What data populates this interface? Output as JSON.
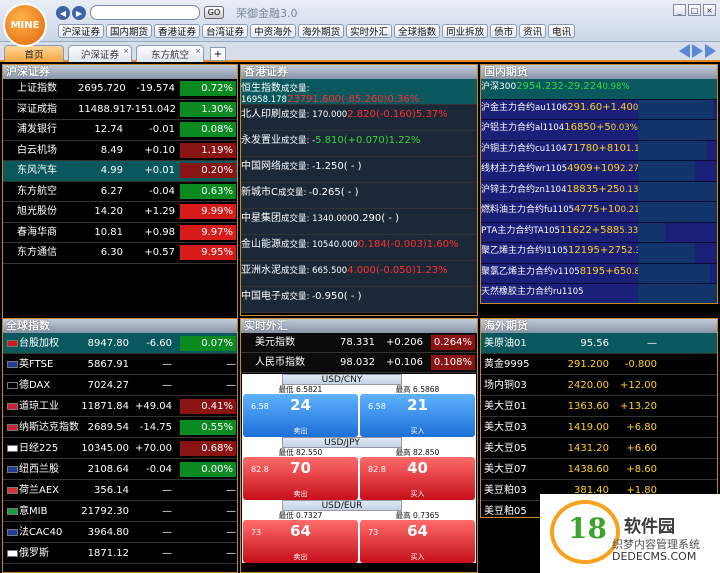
{
  "app": {
    "logo": "MINE",
    "title": "荣御金融3.0",
    "go": "GO",
    "search_value": ""
  },
  "categories": [
    "沪深证券",
    "国内期货",
    "香港证券",
    "台湾证券",
    "中资海外",
    "海外期货",
    "实时外汇",
    "全球指数",
    "同业拆放",
    "债市",
    "资讯",
    "电讯"
  ],
  "tabs": [
    "首页",
    "沪深证券",
    "东方航空"
  ],
  "panels": {
    "sh": {
      "title": "沪深证券",
      "rows": [
        {
          "name": "上证指数",
          "price": "2695.720",
          "chg": "-19.574",
          "pct": "0.72%",
          "c": "g"
        },
        {
          "name": "深证成指",
          "price": "11488.917",
          "chg": "-151.042",
          "pct": "1.30%",
          "c": "g"
        },
        {
          "name": "浦发银行",
          "price": "12.74",
          "chg": "-0.01",
          "pct": "0.08%",
          "c": "g"
        },
        {
          "name": "白云机场",
          "price": "8.49",
          "chg": "+0.10",
          "pct": "1.19%",
          "c": "r"
        },
        {
          "name": "东风汽车",
          "price": "4.99",
          "chg": "+0.01",
          "pct": "0.20%",
          "c": "r",
          "hl": true
        },
        {
          "name": "东方航空",
          "price": "6.27",
          "chg": "-0.04",
          "pct": "0.63%",
          "c": "g"
        },
        {
          "name": "旭光股份",
          "price": "14.20",
          "chg": "+1.29",
          "pct": "9.99%",
          "c": "R"
        },
        {
          "name": "春海华商",
          "price": "10.81",
          "chg": "+0.98",
          "pct": "9.97%",
          "c": "R"
        },
        {
          "name": "东方通信",
          "price": "6.30",
          "chg": "+0.57",
          "pct": "9.95%",
          "c": "R"
        }
      ]
    },
    "hk": {
      "title": "香港证券",
      "rows": [
        {
          "name": "恒生指数",
          "vol": "成交量: 16958.178",
          "price": "23791.600",
          "chg": "(-85.260)",
          "pct": "0.36%",
          "c": "r"
        },
        {
          "name": "北人印刷",
          "vol": "成交量: 170.000",
          "price": "2.820",
          "chg": "(-0.160)",
          "pct": "5.37%",
          "c": "r"
        },
        {
          "name": "永发置业",
          "vol": "成交量: -",
          "price": "5.810",
          "chg": "(+0.070)",
          "pct": "1.22%",
          "c": "g"
        },
        {
          "name": "中国网络",
          "vol": "成交量: -",
          "price": "1.250",
          "chg": "( - )",
          "pct": "",
          "c": "w"
        },
        {
          "name": "新城市C",
          "vol": "成交量: -",
          "price": "0.265",
          "chg": "( - )",
          "pct": "",
          "c": "w"
        },
        {
          "name": "中星集团",
          "vol": "成交量: 1340.000",
          "price": "0.290",
          "chg": "( - )",
          "pct": "",
          "c": "w"
        },
        {
          "name": "金山能源",
          "vol": "成交量: 10540.000",
          "price": "0.184",
          "chg": "(-0.003)",
          "pct": "1.60%",
          "c": "r"
        },
        {
          "name": "亚洲水泥",
          "vol": "成交量: 665.500",
          "price": "4.000",
          "chg": "(-0.050)",
          "pct": "1.23%",
          "c": "r"
        },
        {
          "name": "中国电子",
          "vol": "成交量: -",
          "price": "0.950",
          "chg": "( - )",
          "pct": "",
          "c": "w"
        }
      ]
    },
    "fu": {
      "title": "国内期货",
      "rows": [
        {
          "name": "沪深300",
          "code": "",
          "price": "2954.232",
          "chg": "-29.224",
          "pct": "0.98%",
          "c": "g"
        },
        {
          "name": "沪金主力合约",
          "code": "au1106",
          "price": "291.60",
          "chg": "+1.40",
          "pct": "0.48%",
          "c": "y"
        },
        {
          "name": "沪铝主力合约",
          "code": "al1104",
          "price": "16850",
          "chg": "+5",
          "pct": "0.03%",
          "c": "y"
        },
        {
          "name": "沪铜主力合约",
          "code": "cu1104",
          "price": "71780",
          "chg": "+810",
          "pct": "1.14%",
          "c": "y"
        },
        {
          "name": "线材主力合约",
          "code": "wr1105",
          "price": "4909",
          "chg": "+109",
          "pct": "2.27%",
          "c": "y"
        },
        {
          "name": "沪锌主力合约",
          "code": "zn1104",
          "price": "18835",
          "chg": "+25",
          "pct": "0.13%",
          "c": "y"
        },
        {
          "name": "燃料油主力合约",
          "code": "fu1105",
          "price": "4775",
          "chg": "+10",
          "pct": "0.21%",
          "c": "y"
        },
        {
          "name": "PTA主力合约",
          "code": "TA105",
          "price": "11622",
          "chg": "+588",
          "pct": "5.33%",
          "c": "y"
        },
        {
          "name": "聚乙烯主力合约",
          "code": "l1105",
          "price": "12195",
          "chg": "+275",
          "pct": "2.31%",
          "c": "y"
        },
        {
          "name": "聚氯乙烯主力合约",
          "code": "v1105",
          "price": "8195",
          "chg": "+65",
          "pct": "0.80%",
          "c": "y"
        },
        {
          "name": "天然橡胶主力合约",
          "code": "ru1105",
          "price": "",
          "chg": "",
          "pct": "",
          "c": "y"
        }
      ]
    },
    "gl": {
      "title": "全球指数",
      "rows": [
        {
          "name": "台股加权",
          "price": "8947.80",
          "chg": "-6.60",
          "pct": "0.07%",
          "c": "g",
          "hl": true,
          "flag": "tw"
        },
        {
          "name": "英FTSE",
          "price": "5867.91",
          "chg": "—",
          "pct": "—",
          "c": "n",
          "flag": "uk"
        },
        {
          "name": "德DAX",
          "price": "7024.27",
          "chg": "—",
          "pct": "—",
          "c": "n",
          "flag": "de"
        },
        {
          "name": "道琼工业",
          "price": "11871.84",
          "chg": "+49.04",
          "pct": "0.41%",
          "c": "r",
          "flag": "us"
        },
        {
          "name": "纳斯达克指数",
          "price": "2689.54",
          "chg": "-14.75",
          "pct": "0.55%",
          "c": "g",
          "flag": "us"
        },
        {
          "name": "日经225",
          "price": "10345.00",
          "chg": "+70.00",
          "pct": "0.68%",
          "c": "r",
          "flag": "jp"
        },
        {
          "name": "纽西兰股",
          "price": "2108.64",
          "chg": "-0.04",
          "pct": "0.00%",
          "c": "g",
          "flag": "nz"
        },
        {
          "name": "荷兰AEX",
          "price": "356.14",
          "chg": "—",
          "pct": "—",
          "c": "n",
          "flag": "nl"
        },
        {
          "name": "意MIB",
          "price": "21792.30",
          "chg": "—",
          "pct": "—",
          "c": "n",
          "flag": "it"
        },
        {
          "name": "法CAC40",
          "price": "3964.80",
          "chg": "—",
          "pct": "—",
          "c": "n",
          "flag": "fr"
        },
        {
          "name": "俄罗斯",
          "price": "1871.12",
          "chg": "—",
          "pct": "—",
          "c": "n",
          "flag": "ru"
        }
      ]
    },
    "fx": {
      "title": "实时外汇",
      "rows": [
        {
          "name": "美元指数",
          "price": "78.331",
          "chg": "+0.206",
          "pct": "0.264%"
        },
        {
          "name": "人民币指数",
          "price": "98.032",
          "chg": "+0.106",
          "pct": "0.108%"
        }
      ],
      "pairs": [
        {
          "pair": "USD/CNY",
          "low": "最低 6.5821",
          "high": "最高 6.5868",
          "sell_small": "6.58",
          "sell_big": "24",
          "buy_small": "6.58",
          "buy_big": "21",
          "sell": "卖出",
          "buy": "买入",
          "color": "blue"
        },
        {
          "pair": "USD/JPY",
          "low": "最低 82.550",
          "high": "最高 82.850",
          "sell_small": "82.8",
          "sell_big": "70",
          "buy_small": "82.8",
          "buy_big": "40",
          "sell": "卖出",
          "buy": "买入",
          "color": "redb"
        },
        {
          "pair": "USD/EUR",
          "low": "最低 0.7327",
          "high": "最高 0.7365",
          "sell_small": "73",
          "sell_big": "64",
          "buy_small": "73",
          "buy_big": "64",
          "sell": "卖出",
          "buy": "买入",
          "color": "redb"
        }
      ]
    },
    "of": {
      "title": "海外期货",
      "rows": [
        {
          "name": "美原油01",
          "price": "95.56",
          "chg": "—",
          "hl": true
        },
        {
          "name": "黄金9995",
          "price": "291.200",
          "chg": "-0.800"
        },
        {
          "name": "场内铜03",
          "price": "2420.00",
          "chg": "+12.00"
        },
        {
          "name": "美大豆01",
          "price": "1363.60",
          "chg": "+13.20"
        },
        {
          "name": "美大豆03",
          "price": "1419.00",
          "chg": "+6.80"
        },
        {
          "name": "美大豆05",
          "price": "1431.20",
          "chg": "+6.60"
        },
        {
          "name": "美大豆07",
          "price": "1438.60",
          "chg": "+8.60"
        },
        {
          "name": "美豆粕03",
          "price": "381.40",
          "chg": "+1.80"
        },
        {
          "name": "美豆粕05",
          "price": "",
          "chg": ""
        }
      ]
    }
  },
  "watermark": {
    "num": "18",
    "title": "软件园",
    "sub": "织梦内容管理系统",
    "url": "DEDECMS.COM"
  }
}
